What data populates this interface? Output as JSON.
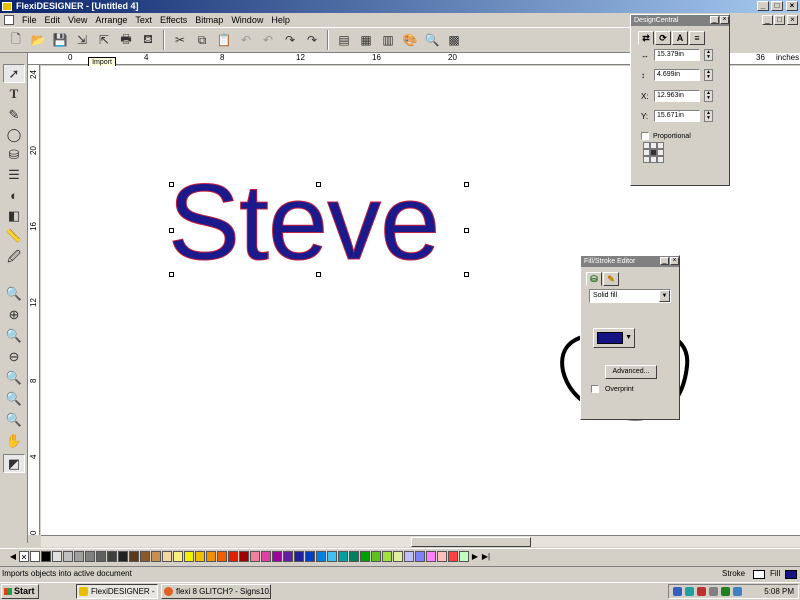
{
  "window": {
    "title": "FlexiDESIGNER - [Untitled 4]"
  },
  "menu": [
    "File",
    "Edit",
    "View",
    "Arrange",
    "Text",
    "Effects",
    "Bitmap",
    "Window",
    "Help"
  ],
  "toolbar": {
    "tooltip": "Import"
  },
  "ruler": {
    "h_labels": [
      "0",
      "4",
      "8",
      "12",
      "16",
      "20",
      "36"
    ],
    "units": "inches",
    "v_labels": [
      "24",
      "20",
      "16",
      "12",
      "8",
      "4",
      "0"
    ]
  },
  "canvas": {
    "text": "Steve",
    "text_fill": "#1a1a8c",
    "text_stroke": "#c02040"
  },
  "design_central": {
    "title": "DesignCentral",
    "width_value": "15.379in",
    "height_value": "4.699in",
    "x_label": "X:",
    "x_value": "12.963in",
    "y_label": "Y:",
    "y_value": "15.671in",
    "proportional": "Proportional"
  },
  "fill_stroke_editor": {
    "title": "Fill/Stroke Editor",
    "fill_type": "Solid fill",
    "fill_color": "#141482",
    "advanced": "Advanced...",
    "overprint": "Overprint"
  },
  "status": {
    "message": "Imports objects into active document",
    "stroke_label": "Stroke",
    "fill_label": "Fill"
  },
  "taskbar": {
    "start": "Start",
    "task1": "FlexiDESIGNER - [Unti...",
    "task2": "flexi 8 GLITCH? - Signs10...",
    "clock": "5:08 PM"
  },
  "palette": [
    "#ffffff",
    "#000000",
    "#e0e0e0",
    "#c0c0c0",
    "#a0a0a0",
    "#808080",
    "#606060",
    "#404040",
    "#202020",
    "#5a3a1a",
    "#8a5a2a",
    "#c89050",
    "#f0d8a0",
    "#f8f080",
    "#f0f000",
    "#f0c000",
    "#f09000",
    "#f06000",
    "#e02000",
    "#a00000",
    "#f080a0",
    "#e040a0",
    "#a000a0",
    "#6020a0",
    "#2020a0",
    "#0040c0",
    "#0080e0",
    "#40c0f0",
    "#00a0a0",
    "#008060",
    "#00a000",
    "#60c020",
    "#a0e040",
    "#e0f0a0",
    "#c0c0ff",
    "#8080ff",
    "#ff80ff",
    "#ffc0c0",
    "#ff4040",
    "#c0ffc0"
  ]
}
